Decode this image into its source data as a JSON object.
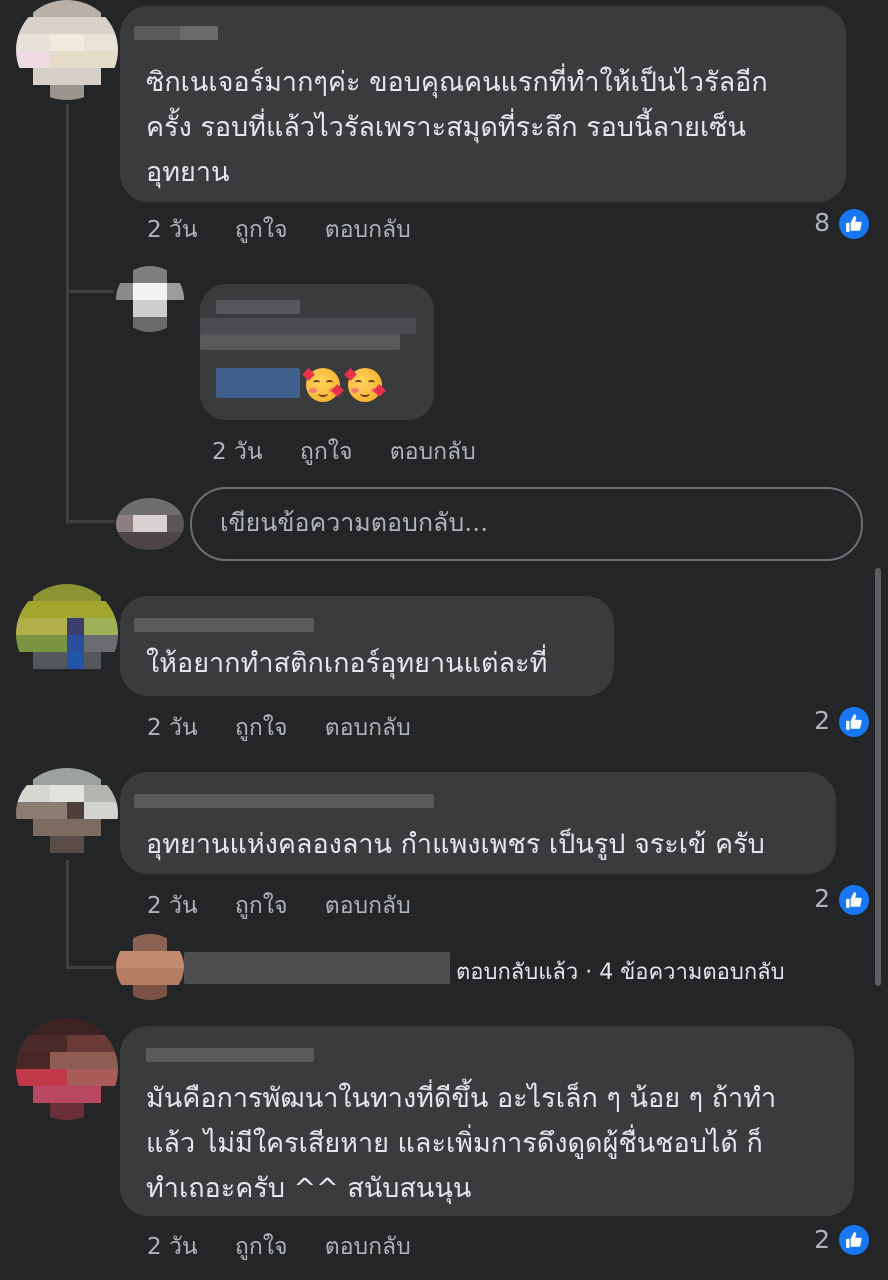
{
  "comments": [
    {
      "text_lines": [
        "ซิกเนเจอร์มากๆค่ะ ขอบคุณคนแรกที่ทำให้เป็นไวรัลอีก",
        "ครั้ง รอบที่แล้วไวรัลเพราะสมุดที่ระลึก รอบนี้ลายเซ็น",
        "อุทยาน"
      ],
      "time": "2 วัน",
      "like_label": "ถูกใจ",
      "reply_label": "ตอบกลับ",
      "reaction_count": "8"
    },
    {
      "text_lines": [
        "ให้อยากทำสติกเกอร์อุทยานแต่ละที่"
      ],
      "time": "2 วัน",
      "like_label": "ถูกใจ",
      "reply_label": "ตอบกลับ",
      "reaction_count": "2"
    },
    {
      "text_lines": [
        "อุทยานแห่งคลองลาน กำแพงเพชร เป็นรูป จระเข้ ครับ"
      ],
      "time": "2 วัน",
      "like_label": "ถูกใจ",
      "reply_label": "ตอบกลับ",
      "reaction_count": "2"
    },
    {
      "text_lines": [
        "มันคือการพัฒนาในทางที่ดีขึ้น อะไรเล็ก ๆ น้อย ๆ ถ้าทำ",
        "แล้ว ไม่มีใครเสียหาย และเพิ่มการดึงดูดผู้ชื่นชอบได้ ก็",
        "ทำเถอะครับ ^^ สนับสนนุน"
      ],
      "time": "2 วัน",
      "like_label": "ถูกใจ",
      "reply_label": "ตอบกลับ",
      "reaction_count": "2"
    }
  ],
  "reply": {
    "time": "2 วัน",
    "like_label": "ถูกใจ",
    "reply_label": "ตอบกลับ",
    "emojis": [
      "smiling-face-with-hearts",
      "smiling-face-with-hearts"
    ]
  },
  "reply_input": {
    "placeholder": "เขียนข้อความตอบกลับ..."
  },
  "replies_summary": {
    "text": "ตอบกลับแล้ว · 4 ข้อความตอบกลับ"
  },
  "colors": {
    "background": "#242526",
    "bubble": "#3a3b3c",
    "like_blue": "#1877f2",
    "meta_text": "#b0b3b8"
  }
}
